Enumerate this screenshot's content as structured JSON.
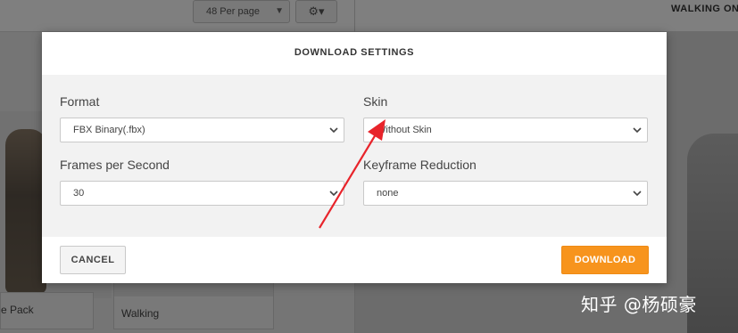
{
  "background": {
    "per_page_select": "48 Per page",
    "right_header_title": "WALKING ON",
    "card_left_label": "e Pack",
    "card_middle_label": "Walking"
  },
  "dialog": {
    "title": "DOWNLOAD SETTINGS",
    "fields": {
      "format": {
        "label": "Format",
        "value": "FBX Binary(.fbx)"
      },
      "skin": {
        "label": "Skin",
        "value": "Without Skin"
      },
      "fps": {
        "label": "Frames per Second",
        "value": "30"
      },
      "keyframe_reduction": {
        "label": "Keyframe Reduction",
        "value": "none"
      }
    },
    "buttons": {
      "cancel": "CANCEL",
      "download": "DOWNLOAD"
    }
  },
  "annotation": {
    "arrow_color": "#e8242b"
  },
  "watermark": "知乎 @杨硕豪",
  "colors": {
    "accent": "#f7941d",
    "overlay": "rgba(0,0,0,0.5)"
  },
  "icons": {
    "dropdown": "chevron-down-icon",
    "settings": "gear-icon"
  }
}
